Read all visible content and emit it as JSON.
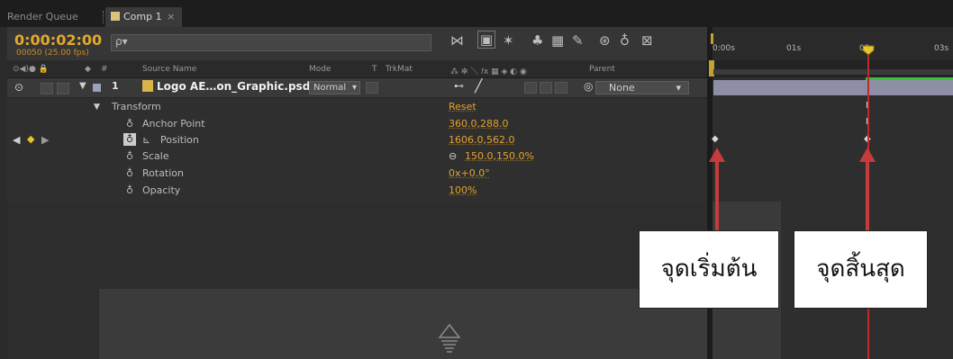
{
  "tabs": {
    "render_queue": "Render Queue",
    "comp": "Comp 1",
    "close": "×"
  },
  "comp_bar": {
    "timecode": "0:00:02:00",
    "frame_rate": "00050 (25.00 fps)",
    "search_placeholder": "",
    "search_icon": "ρ▾"
  },
  "columns": {
    "hash": "#",
    "source_name": "Source Name",
    "mode": "Mode",
    "t": "T",
    "trkmat": "TrkMat",
    "parent": "Parent"
  },
  "layer": {
    "index": "1",
    "name": "Logo AE…on_Graphic.psd",
    "mode": "Normal",
    "parent": "None"
  },
  "transform": {
    "group_label": "Transform",
    "reset_label": "Reset",
    "properties": [
      {
        "label": "Anchor Point",
        "value": "360.0,288.0"
      },
      {
        "label": "Position",
        "value": "1606.0,562.0"
      },
      {
        "label": "Scale",
        "value": "150.0,150.0%",
        "link_icon": "⊖"
      },
      {
        "label": "Rotation",
        "value": "0x+0.0°"
      },
      {
        "label": "Opacity",
        "value": "100%"
      }
    ]
  },
  "timeline": {
    "ticks": [
      "0:00s",
      "01s",
      "02s",
      "03s"
    ]
  },
  "annotations": {
    "start_label": "จุดเริ่มต้น",
    "end_label": "จุดสิ้นสุด"
  },
  "colors": {
    "timecode": "#e3a82b",
    "value": "#e3a22e",
    "playhead": "#c02a2a",
    "layer_bar": "#8e8ea6",
    "arrow": "#c63b3b"
  }
}
